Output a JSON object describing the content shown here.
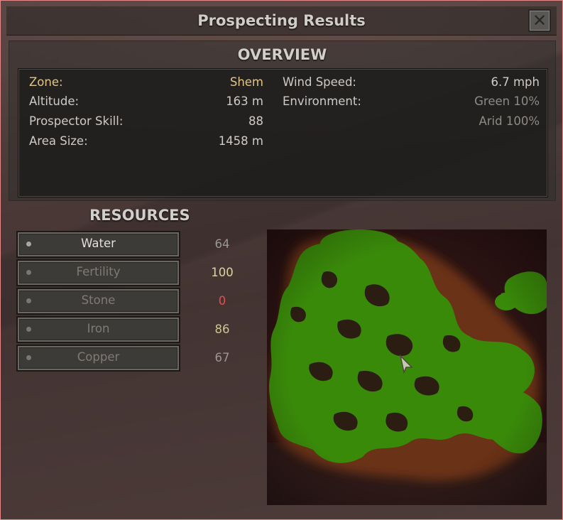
{
  "window": {
    "title": "Prospecting Results",
    "close_symbol": "✕"
  },
  "overview": {
    "heading": "OVERVIEW",
    "left": [
      {
        "label": "Zone:",
        "value": "Shem"
      },
      {
        "label": "Altitude:",
        "value": "163 m"
      },
      {
        "label": "Prospector Skill:",
        "value": "88"
      },
      {
        "label": "Area Size:",
        "value": "1458 m"
      }
    ],
    "right": [
      {
        "label": "Wind Speed:",
        "value": "6.7 mph"
      },
      {
        "label": "Environment:",
        "value": "Green 10%"
      },
      {
        "label": "",
        "value": "Arid 100%"
      }
    ]
  },
  "resources": {
    "heading": "RESOURCES",
    "items": [
      {
        "name": "Water",
        "value": "64",
        "value_color": "#9a9692",
        "active": true
      },
      {
        "name": "Fertility",
        "value": "100",
        "value_color": "#d8d6a0",
        "active": false
      },
      {
        "name": "Stone",
        "value": "0",
        "value_color": "#e05050",
        "active": false
      },
      {
        "name": "Iron",
        "value": "86",
        "value_color": "#c9c78e",
        "active": false
      },
      {
        "name": "Copper",
        "value": "67",
        "value_color": "#9a9692",
        "active": false
      }
    ]
  },
  "colors": {
    "accent_label": "#e0c48a",
    "map_green": "#3a8a0a",
    "map_dark": "#2a1212"
  }
}
